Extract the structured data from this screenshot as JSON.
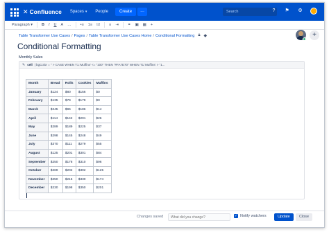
{
  "topnav": {
    "logo_text": "Confluence",
    "spaces_label": "Spaces",
    "people_label": "People",
    "create_label": "Create",
    "more_label": "···",
    "search_placeholder": "Search",
    "help_icon": "?",
    "notifications_icon": "⚑",
    "settings_icon": "⚙"
  },
  "toolbar": {
    "paragraph_label": "Paragraph",
    "bold": "B",
    "italic": "I",
    "underline": "U",
    "color": "A",
    "more_format": "…",
    "bullet_list": "•≡",
    "number_list": "1≡",
    "task_list": "☑",
    "align_left": "≡",
    "align_indent": "⇥",
    "link": "⚭",
    "image": "▣",
    "table": "▦",
    "insert": "+"
  },
  "breadcrumb": {
    "items": [
      "Table Transformer Use Cases",
      "Pages",
      "Table Transformer Use Cases Home",
      "Conditional Formatting"
    ],
    "separator": "/"
  },
  "page": {
    "title": "Conditional Formatting",
    "subtitle": "Monthly Sales"
  },
  "macro": {
    "icon": "✎",
    "name": "cell",
    "params": "| bgColor = \" > CASE WHEN T1.'Muffins' <= \"100\" THEN \"#FA7E70\" WHEN T1.'Muffins' > \"1..."
  },
  "table": {
    "headers": [
      "Month",
      "Bread",
      "Rolls",
      "Cookies",
      "Muffins"
    ],
    "rows": [
      [
        "January",
        "$124",
        "$80",
        "$156",
        "$0"
      ],
      [
        "February",
        "$135",
        "$79",
        "$179",
        "$0"
      ],
      [
        "March",
        "$245",
        "$96",
        "$186",
        "$14"
      ],
      [
        "April",
        "$114",
        "$142",
        "$201",
        "$26"
      ],
      [
        "May",
        "$289",
        "$189",
        "$225",
        "$37"
      ],
      [
        "June",
        "$298",
        "$145",
        "$248",
        "$49"
      ],
      [
        "July",
        "$370",
        "$111",
        "$279",
        "$55"
      ],
      [
        "August",
        "$125",
        "$201",
        "$301",
        "$84"
      ],
      [
        "September",
        "$250",
        "$178",
        "$310",
        "$96"
      ],
      [
        "October",
        "$269",
        "$202",
        "$302",
        "$125"
      ],
      [
        "November",
        "$250",
        "$215",
        "$330",
        "$174"
      ],
      [
        "December",
        "$230",
        "$198",
        "$350",
        "$201"
      ]
    ]
  },
  "bottombar": {
    "status": "Changes saved",
    "comment_placeholder": "What did you change?",
    "notify_label": "Notify watchers",
    "update_label": "Update",
    "close_label": "Close"
  }
}
